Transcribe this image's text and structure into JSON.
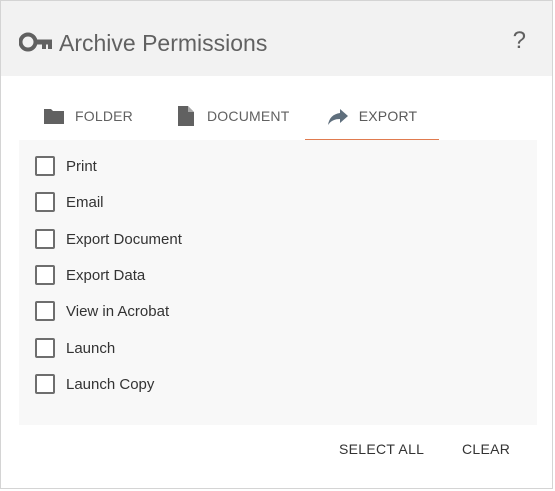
{
  "dialog": {
    "title": "Archive Permissions",
    "title_icon": "key-icon",
    "help_label": "?"
  },
  "tabs": [
    {
      "label": "FOLDER",
      "icon": "folder-icon",
      "active": false
    },
    {
      "label": "DOCUMENT",
      "icon": "document-icon",
      "active": false
    },
    {
      "label": "EXPORT",
      "icon": "share-arrow-icon",
      "active": true
    }
  ],
  "permissions": [
    {
      "label": "Print",
      "checked": false
    },
    {
      "label": "Email",
      "checked": false
    },
    {
      "label": "Export Document",
      "checked": false
    },
    {
      "label": "Export Data",
      "checked": false
    },
    {
      "label": "View in Acrobat",
      "checked": false
    },
    {
      "label": "Launch",
      "checked": false
    },
    {
      "label": "Launch Copy",
      "checked": false
    }
  ],
  "actions": {
    "select_all_label": "SELECT ALL",
    "clear_label": "CLEAR"
  },
  "colors": {
    "header_bg": "#f2f2f2",
    "active_tab_underline": "#e07b4f",
    "icon_gray": "#616161",
    "panel_bg": "#f8f8f8"
  }
}
